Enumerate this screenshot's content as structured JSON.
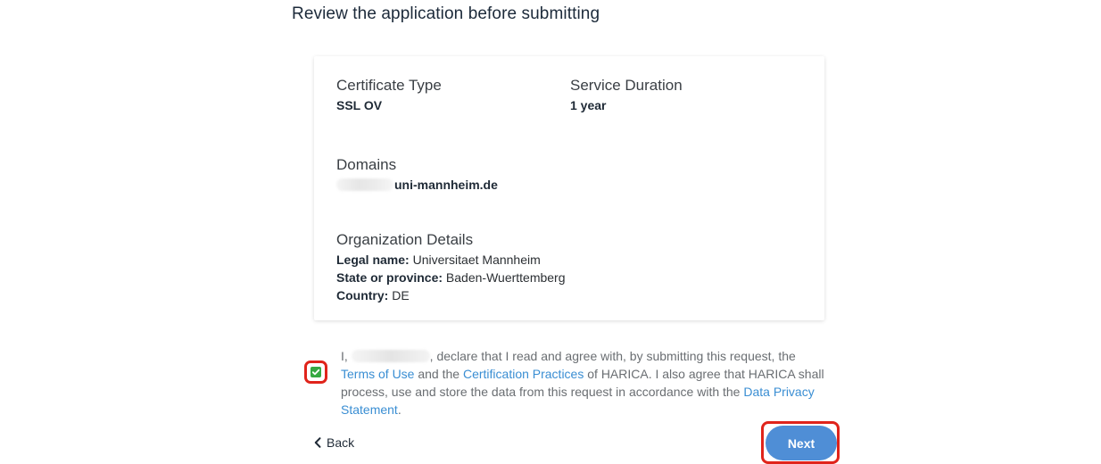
{
  "page": {
    "title": "Review the application before submitting"
  },
  "summary": {
    "certificate_type": {
      "label": "Certificate Type",
      "value": "SSL OV"
    },
    "service_duration": {
      "label": "Service Duration",
      "value": "1 year"
    },
    "domains": {
      "label": "Domains",
      "value": "uni-mannheim.de"
    },
    "organization": {
      "label": "Organization Details",
      "legal_name_label": "Legal name:",
      "legal_name": "Universitaet Mannheim",
      "state_label": "State or province:",
      "state": "Baden-Wuerttemberg",
      "country_label": "Country:",
      "country": "DE"
    }
  },
  "consent": {
    "checked": true,
    "text_prefix": "I,",
    "text_part1": ", declare that I read and agree with, by submitting this request, the",
    "terms_link": "Terms of Use",
    "text_part2": "and the",
    "practices_link": "Certification Practices",
    "text_part3": "of HARICA. I also agree that HARICA shall process, use and store the data from this request in accordance with the",
    "privacy_link": "Data Privacy Statement",
    "text_suffix": "."
  },
  "actions": {
    "back_label": "Back",
    "next_label": "Next"
  },
  "colors": {
    "accent": "#4f8ed6",
    "link": "#3a8ed3",
    "highlight": "#e0241b",
    "check": "#36a942"
  },
  "icons": {
    "back": "chevron-left-icon",
    "checkbox": "checkmark-icon"
  }
}
